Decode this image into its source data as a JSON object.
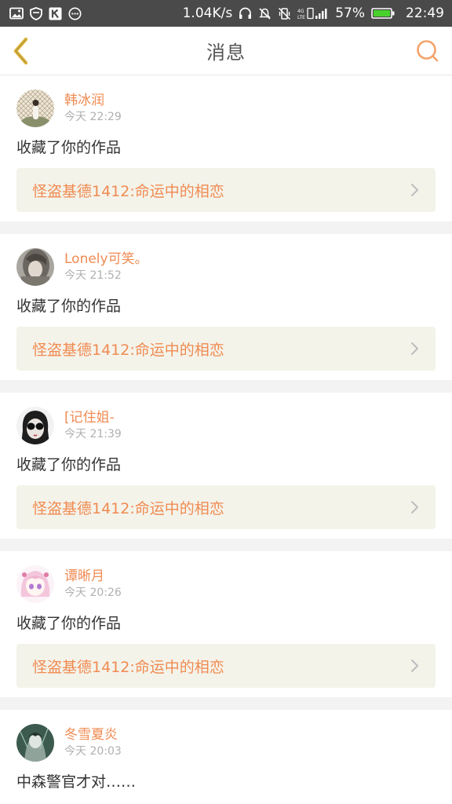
{
  "status_bar": {
    "network_speed": "1.04K/s",
    "battery_percent": "57%",
    "time": "22:49",
    "icons": [
      "image-icon",
      "shield-icon",
      "k-app-icon",
      "chat-bubble-icon",
      "headphones-icon",
      "mute-icon",
      "vibrate-off-icon",
      "signal-icon",
      "battery-icon"
    ],
    "colors": {
      "bar_background": "#4a4a4a",
      "battery_fill": "#48d12d"
    }
  },
  "header": {
    "title": "消息",
    "back_icon": "chevron-left-icon",
    "search_icon": "search-icon",
    "colors": {
      "back": "#e2ba3f",
      "search": "#f4a36a"
    }
  },
  "theme": {
    "accent": "#f08b52",
    "link_background": "#f4f3ea",
    "page_background": "#f3f3f3"
  },
  "messages": [
    {
      "username": "韩冰润",
      "timestamp": "今天 22:29",
      "action": "收藏了你的作品",
      "work_title": "怪盗基德1412:命运中的相恋"
    },
    {
      "username": "Lonely可笑。",
      "timestamp": "今天 21:52",
      "action": "收藏了你的作品",
      "work_title": "怪盗基德1412:命运中的相恋"
    },
    {
      "username": "[记住姐-",
      "timestamp": "今天 21:39",
      "action": "收藏了你的作品",
      "work_title": "怪盗基德1412:命运中的相恋"
    },
    {
      "username": "谭晰月",
      "timestamp": "今天 20:26",
      "action": "收藏了你的作品",
      "work_title": "怪盗基德1412:命运中的相恋"
    },
    {
      "username": "冬雪夏炎",
      "timestamp": "今天 20:03",
      "action": "中森警官才对……"
    }
  ]
}
